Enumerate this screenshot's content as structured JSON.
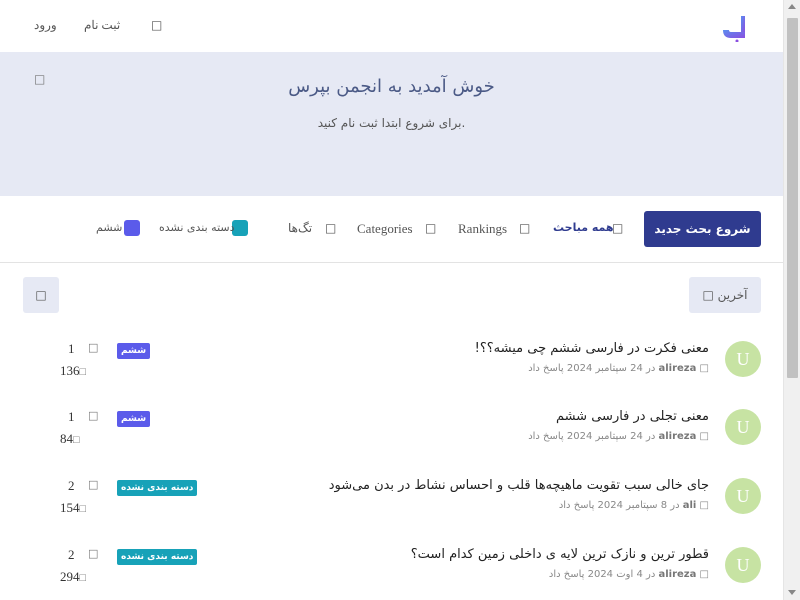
{
  "colors": {
    "primary": "#2f3b8f",
    "hero_bg": "#e6e9f4",
    "tag_sixth": "#5b5bea",
    "tag_uncategorized": "#17a2b8",
    "avatar_bg": "#c7e3a3"
  },
  "header": {
    "login_label": "ورود",
    "signup_label": "ثبت نام",
    "search_icon": "search-icon",
    "logo_icon": "logo-icon"
  },
  "hero": {
    "title": "خوش آمدید به انجمن بپرس",
    "subtitle": "برای شروع ابتدا ثبت نام کنید.",
    "close_icon": "close-icon"
  },
  "nav": {
    "start_discussion_label": "شروع بحث جدید",
    "all_discussions_label": "همه مباحث",
    "rankings_label": "Rankings",
    "categories_label": "Categories",
    "tags_label": "تگ‌ها",
    "tags": [
      {
        "label": "دسته بندی نشده",
        "color": "#17a2b8"
      },
      {
        "label": "ششم",
        "color": "#5b5bea"
      }
    ]
  },
  "toolbar": {
    "sort_label": "آخرین",
    "refresh_icon": "refresh-icon"
  },
  "discussions": [
    {
      "avatar_letter": "U",
      "title": "معنی فکرت در فارسی ششم چی میشه؟؟!",
      "user": "alireza",
      "meta_text": "در 24 سپتامبر 2024 پاسخ داد",
      "badge": "ششم",
      "badge_color": "#5b5bea",
      "replies": "1",
      "views": "136"
    },
    {
      "avatar_letter": "U",
      "title": "معنی تجلی در فارسی ششم",
      "user": "alireza",
      "meta_text": "در 24 سپتامبر 2024 پاسخ داد",
      "badge": "ششم",
      "badge_color": "#5b5bea",
      "replies": "1",
      "views": "84"
    },
    {
      "avatar_letter": "U",
      "title": "جای خالی سبب تقویت ماهیچه‌ها قلب و احساس نشاط در بدن می‌شود",
      "user": "ali",
      "meta_text": "در 8 سپتامبر 2024 پاسخ داد",
      "badge": "دسته بندی نشده",
      "badge_color": "#17a2b8",
      "replies": "2",
      "views": "154"
    },
    {
      "avatar_letter": "U",
      "title": "قطور ترین و نازک ترین لایه ی داخلی زمین کدام است؟",
      "user": "alireza",
      "meta_text": "در 4 اوت 2024 پاسخ داد",
      "badge": "دسته بندی نشده",
      "badge_color": "#17a2b8",
      "replies": "2",
      "views": "294"
    }
  ]
}
